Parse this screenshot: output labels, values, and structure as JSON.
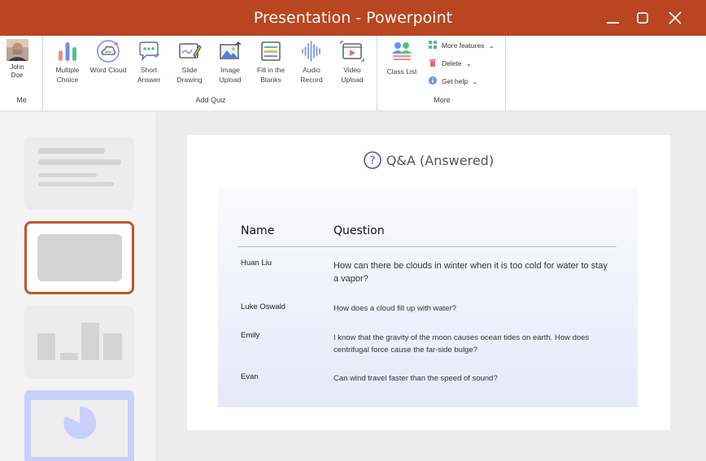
{
  "window": {
    "title": "Presentation - Powerpoint"
  },
  "ribbon": {
    "me": {
      "user_name": "John Doe",
      "group_label": "Me"
    },
    "add_quiz": {
      "group_label": "Add Quiz",
      "tools": [
        {
          "label": "Multiple Choice",
          "icon": "bar-chart-icon"
        },
        {
          "label": "Word Cloud",
          "icon": "word-cloud-icon"
        },
        {
          "label": "Short Answer",
          "icon": "chat-bubble-icon"
        },
        {
          "label": "Slide Drawing",
          "icon": "drawing-pen-icon"
        },
        {
          "label": "Image Upload",
          "icon": "image-upload-icon"
        },
        {
          "label": "Fill in the Blanks",
          "icon": "fill-blanks-icon"
        },
        {
          "label": "Audio Record",
          "icon": "audio-wave-icon"
        },
        {
          "label": "Video Upload",
          "icon": "video-upload-icon"
        }
      ]
    },
    "more": {
      "group_label": "More",
      "class_list_label": "Class List",
      "items": [
        {
          "label": "More features",
          "icon": "grid-icon"
        },
        {
          "label": "Delete",
          "icon": "trash-icon"
        },
        {
          "label": "Get help",
          "icon": "info-icon"
        }
      ]
    }
  },
  "slide": {
    "title": "Q&A (Answered)",
    "table": {
      "headers": [
        "Name",
        "Question"
      ],
      "rows": [
        {
          "name": "Huan Liu",
          "question": "How can there be clouds in winter when it is too cold for water to stay a vapor?"
        },
        {
          "name": "Luke Oswald",
          "question": "How does a cloud fill up with water?"
        },
        {
          "name": "Emily",
          "question": "I know that the gravity of the moon causes ocean tides on earth. How does centrifugal force cause the far-side bulge?"
        },
        {
          "name": "Evan",
          "question": "Can wind travel faster than the speed of sound?"
        }
      ]
    }
  },
  "colors": {
    "accent": "#b94621",
    "selected_thumb_border": "#c5522c",
    "qa_panel": "#eef0fb"
  }
}
